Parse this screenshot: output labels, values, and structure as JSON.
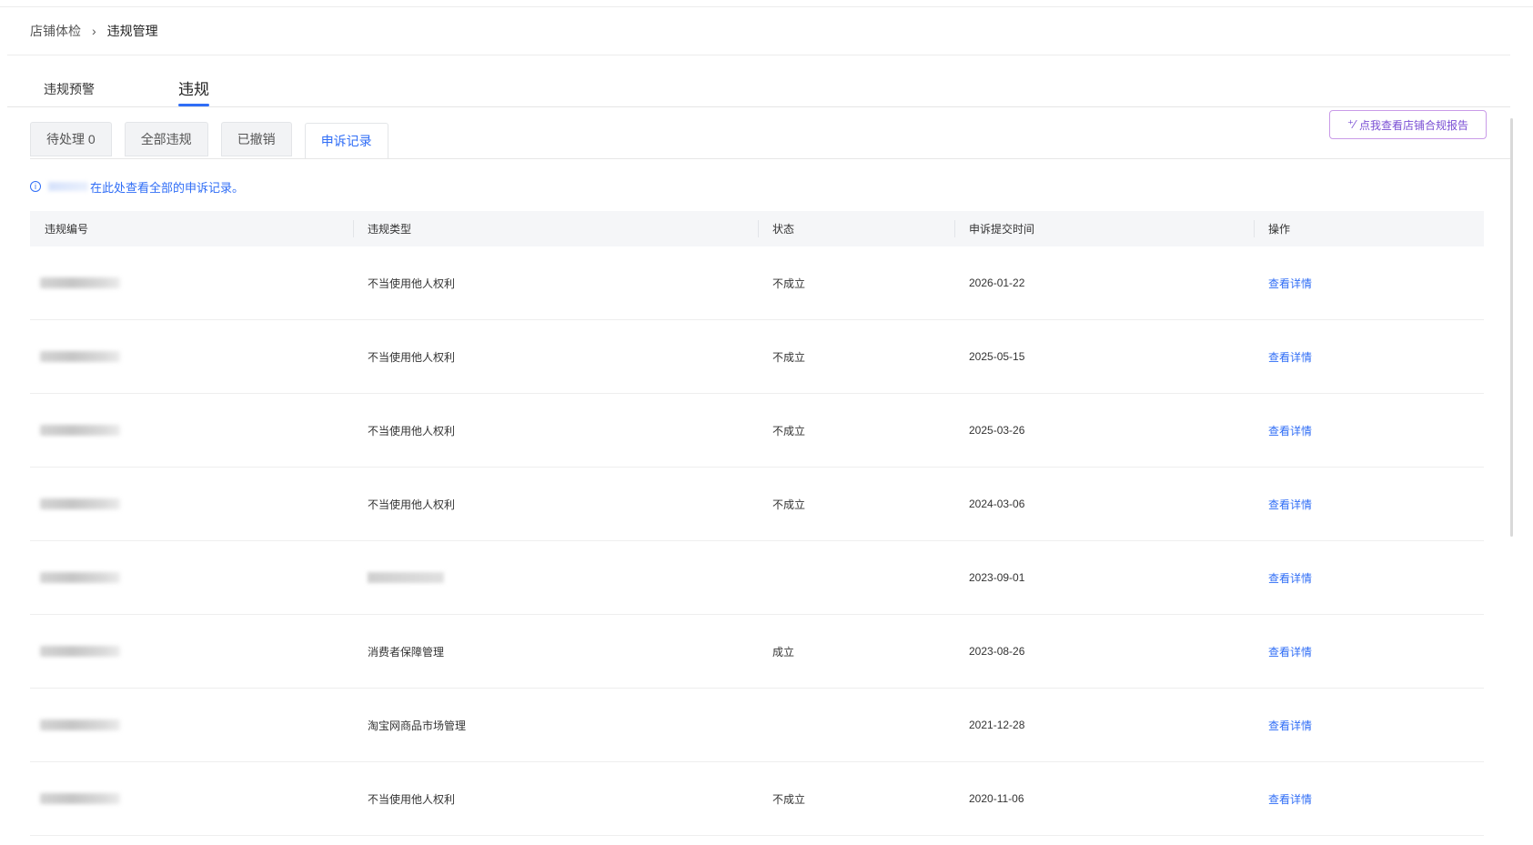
{
  "breadcrumb": {
    "root": "店铺体检",
    "separator": "›",
    "current": "违规管理"
  },
  "main_tabs": [
    {
      "label": "违规预警",
      "active": false
    },
    {
      "label": "违规",
      "active": true
    }
  ],
  "sub_tabs": [
    {
      "label": "待处理 0",
      "active": false
    },
    {
      "label": "全部违规",
      "active": false
    },
    {
      "label": "已撤销",
      "active": false
    },
    {
      "label": "申诉记录",
      "active": true
    }
  ],
  "report_button": {
    "icon": "sparkle-icon",
    "label": "点我查看店铺合规报告"
  },
  "notice": {
    "icon": "info-icon",
    "text": "在此处查看全部的申诉记录。"
  },
  "table": {
    "headers": [
      "违规编号",
      "违规类型",
      "状态",
      "申诉提交时间",
      "操作"
    ],
    "rows": [
      {
        "type": "不当使用他人权利",
        "status": "不成立",
        "date": "2026-01-22",
        "action": "查看详情"
      },
      {
        "type": "不当使用他人权利",
        "status": "不成立",
        "date": "2025-05-15",
        "action": "查看详情"
      },
      {
        "type": "不当使用他人权利",
        "status": "不成立",
        "date": "2025-03-26",
        "action": "查看详情"
      },
      {
        "type": "不当使用他人权利",
        "status": "不成立",
        "date": "2024-03-06",
        "action": "查看详情"
      },
      {
        "type": "",
        "status": "",
        "date": "2023-09-01",
        "action": "查看详情"
      },
      {
        "type": "消费者保障管理",
        "status": "成立",
        "date": "2023-08-26",
        "action": "查看详情"
      },
      {
        "type": "淘宝网商品市场管理",
        "status": "",
        "date": "2021-12-28",
        "action": "查看详情"
      },
      {
        "type": "不当使用他人权利",
        "status": "不成立",
        "date": "2020-11-06",
        "action": "查看详情"
      }
    ]
  },
  "colors": {
    "accent": "#2f6df6",
    "report_border": "#c99be8",
    "report_text": "#7a4fd4"
  }
}
